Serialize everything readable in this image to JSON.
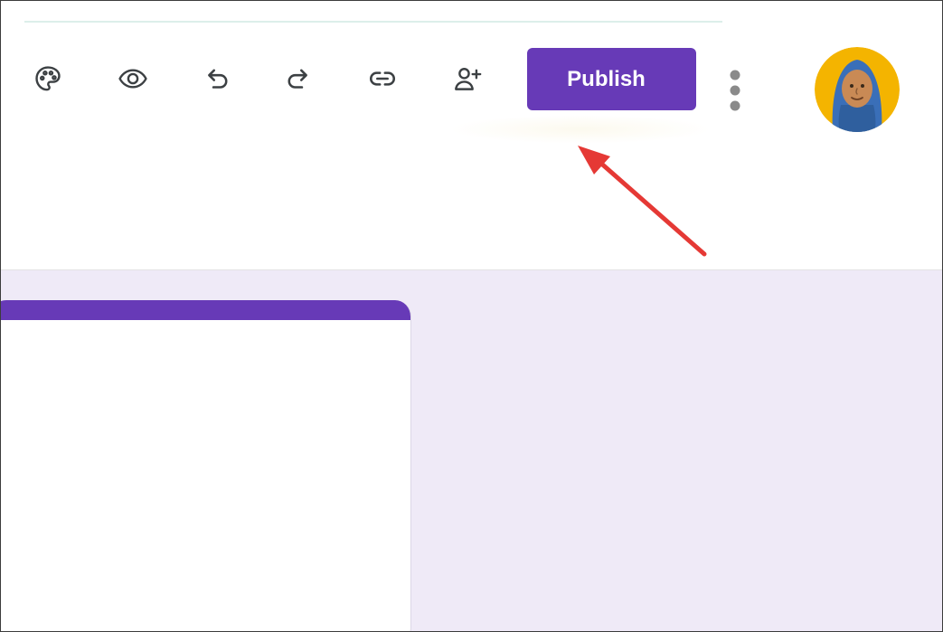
{
  "toolbar": {
    "icons": {
      "customize": "palette-icon",
      "preview": "eye-icon",
      "undo": "undo-icon",
      "redo": "redo-icon",
      "link": "link-icon",
      "collaborators": "add-person-icon",
      "more": "more-vert-icon"
    },
    "publish_label": "Publish"
  },
  "avatar": {
    "icon": "avatar-illustration"
  },
  "colors": {
    "accent": "#673ab7",
    "canvas": "#efeaf7",
    "icon": "#5f6368",
    "annotation_arrow": "#e53935",
    "avatar_bg": "#f4b400",
    "avatar_scarf": "#3a6fb8"
  },
  "annotation": {
    "icon": "red-arrow",
    "target": "publish"
  }
}
